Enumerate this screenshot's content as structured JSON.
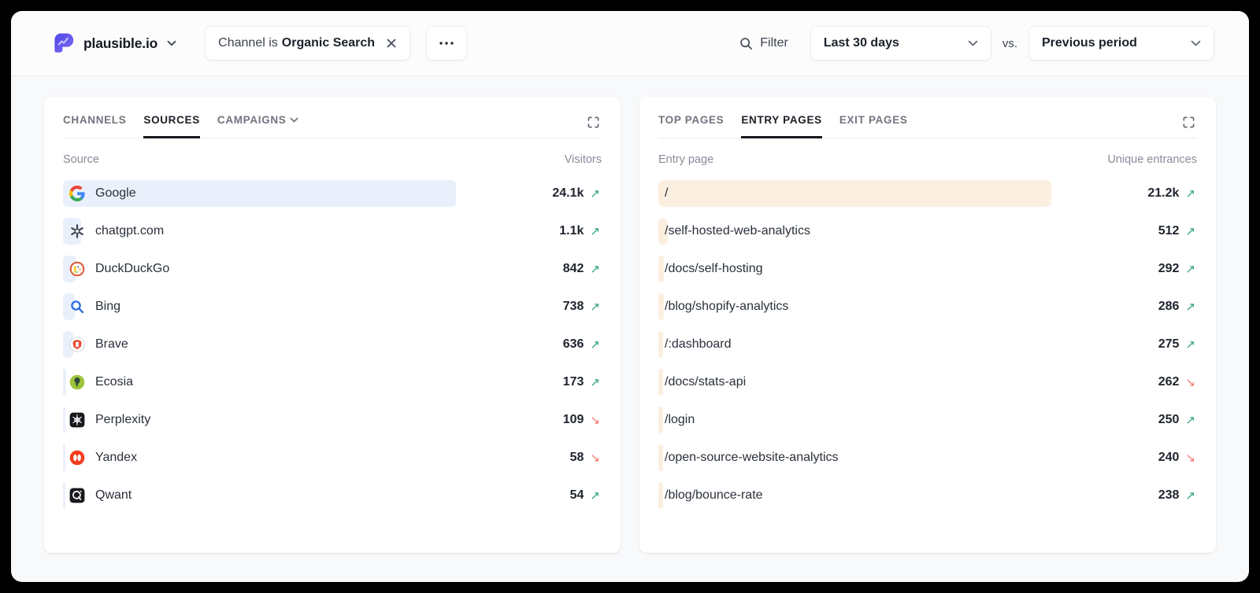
{
  "topbar": {
    "site_name": "plausible.io",
    "filter_chip": {
      "prefix": "Channel is",
      "value": "Organic Search"
    },
    "filter_label": "Filter",
    "date_range": "Last 30 days",
    "vs_label": "vs.",
    "compare": "Previous period"
  },
  "icons": {
    "trend_up_glyph": "↗",
    "trend_down_glyph": "↘"
  },
  "colors": {
    "sources_bar": "#e9f0fb",
    "pages_bar": "#fbefdf",
    "trend_up": "#2fa279",
    "trend_down": "#f4746b",
    "brand_indigo": "#5850ec"
  },
  "sources_card": {
    "tabs": [
      {
        "label": "CHANNELS",
        "active": false,
        "has_chevron": false
      },
      {
        "label": "SOURCES",
        "active": true,
        "has_chevron": false
      },
      {
        "label": "CAMPAIGNS",
        "active": false,
        "has_chevron": true
      }
    ],
    "col_left": "Source",
    "col_right": "Visitors",
    "rows": [
      {
        "label": "Google",
        "icon": "google-icon",
        "value": "24.1k",
        "trend": "up",
        "pct": 100
      },
      {
        "label": "chatgpt.com",
        "icon": "chatgpt-icon",
        "value": "1.1k",
        "trend": "up",
        "pct": 4.6
      },
      {
        "label": "DuckDuckGo",
        "icon": "duckduckgo-icon",
        "value": "842",
        "trend": "up",
        "pct": 3.5
      },
      {
        "label": "Bing",
        "icon": "bing-icon",
        "value": "738",
        "trend": "up",
        "pct": 3.1
      },
      {
        "label": "Brave",
        "icon": "brave-icon",
        "value": "636",
        "trend": "up",
        "pct": 2.6
      },
      {
        "label": "Ecosia",
        "icon": "ecosia-icon",
        "value": "173",
        "trend": "up",
        "pct": 0.75
      },
      {
        "label": "Perplexity",
        "icon": "perplexity-icon",
        "value": "109",
        "trend": "down",
        "pct": 0.45
      },
      {
        "label": "Yandex",
        "icon": "yandex-icon",
        "value": "58",
        "trend": "down",
        "pct": 0.25
      },
      {
        "label": "Qwant",
        "icon": "qwant-icon",
        "value": "54",
        "trend": "up",
        "pct": 0.22
      }
    ]
  },
  "pages_card": {
    "tabs": [
      {
        "label": "TOP PAGES",
        "active": false,
        "has_chevron": false
      },
      {
        "label": "ENTRY PAGES",
        "active": true,
        "has_chevron": false
      },
      {
        "label": "EXIT PAGES",
        "active": false,
        "has_chevron": false
      }
    ],
    "col_left": "Entry page",
    "col_right": "Unique entrances",
    "rows": [
      {
        "label": "/",
        "icon": null,
        "value": "21.2k",
        "trend": "up",
        "pct": 100
      },
      {
        "label": "/self-hosted-web-analytics",
        "icon": null,
        "value": "512",
        "trend": "up",
        "pct": 2.4
      },
      {
        "label": "/docs/self-hosting",
        "icon": null,
        "value": "292",
        "trend": "up",
        "pct": 1.4
      },
      {
        "label": "/blog/shopify-analytics",
        "icon": null,
        "value": "286",
        "trend": "up",
        "pct": 1.35
      },
      {
        "label": "/:dashboard",
        "icon": null,
        "value": "275",
        "trend": "up",
        "pct": 1.3
      },
      {
        "label": "/docs/stats-api",
        "icon": null,
        "value": "262",
        "trend": "down",
        "pct": 1.24
      },
      {
        "label": "/login",
        "icon": null,
        "value": "250",
        "trend": "up",
        "pct": 1.18
      },
      {
        "label": "/open-source-website-analytics",
        "icon": null,
        "value": "240",
        "trend": "down",
        "pct": 1.13
      },
      {
        "label": "/blog/bounce-rate",
        "icon": null,
        "value": "238",
        "trend": "up",
        "pct": 1.12
      }
    ]
  }
}
